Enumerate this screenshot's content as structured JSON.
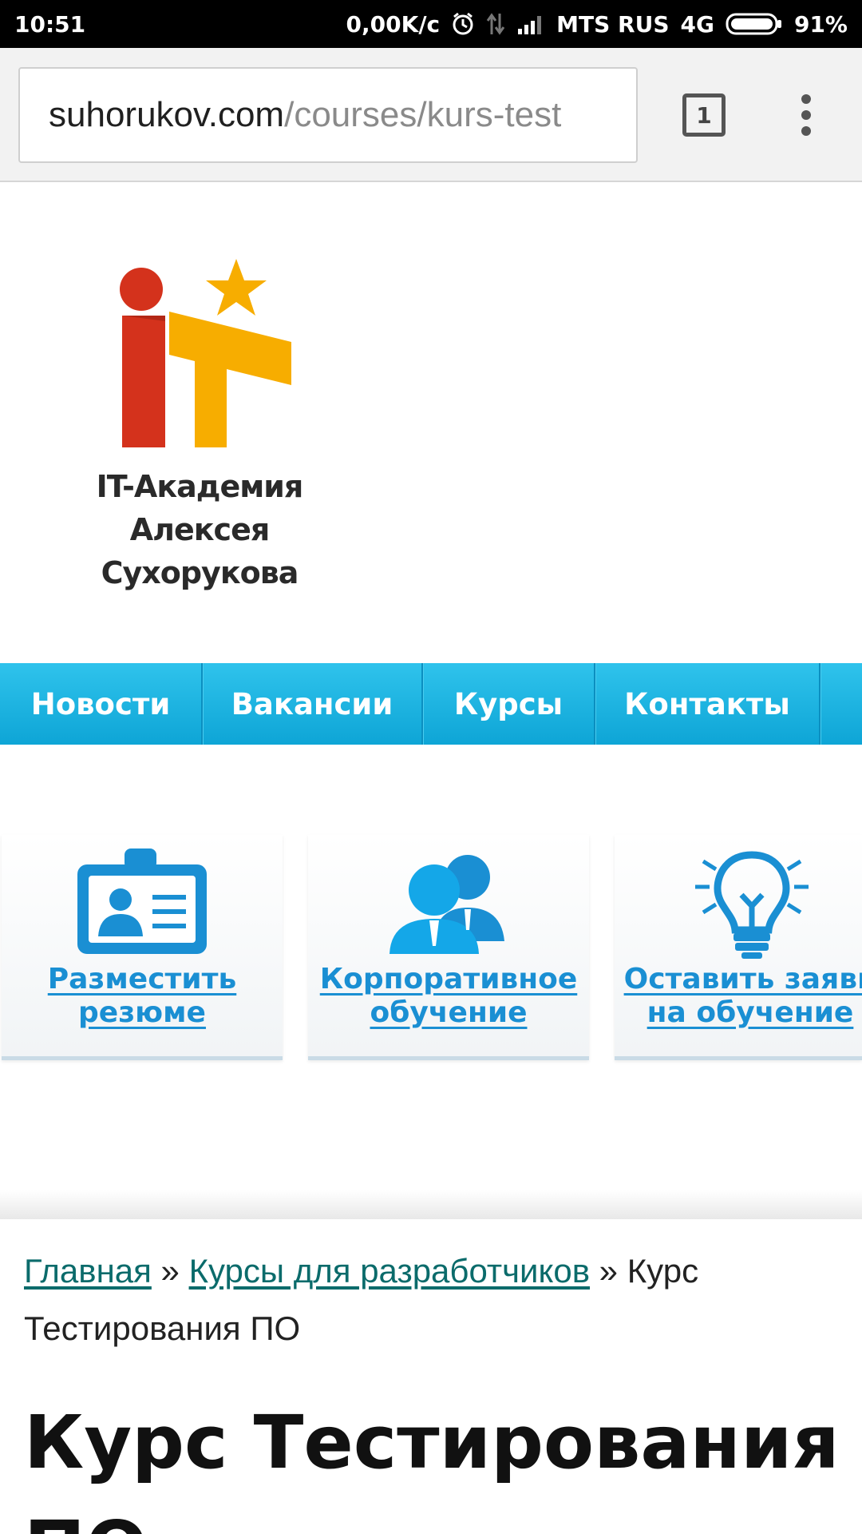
{
  "status_bar": {
    "time": "10:51",
    "net_speed": "0,00K/c",
    "carrier": "MTS RUS",
    "network": "4G",
    "battery": "91%"
  },
  "browser": {
    "url_host": "suhorukov.com",
    "url_path": "/courses/kurs-test",
    "tab_count": "1"
  },
  "logo": {
    "line1": "IT-Академия",
    "line2": "Алексея Сухорукова",
    "colors": {
      "i": "#d4321c",
      "t": "#f7ad00",
      "star": "#f7ad00"
    }
  },
  "nav": {
    "items": [
      {
        "label": "Новости"
      },
      {
        "label": "Вакансии"
      },
      {
        "label": "Курсы"
      },
      {
        "label": "Контакты"
      },
      {
        "label": ""
      }
    ]
  },
  "cards": [
    {
      "line1": "Разместить",
      "line2": "резюме",
      "icon": "resume-badge-icon"
    },
    {
      "line1": "Корпоративное",
      "line2": "обучение",
      "icon": "people-group-icon"
    },
    {
      "line1": "Оставить заявк",
      "line2": "на обучение",
      "icon": "lightbulb-icon"
    }
  ],
  "breadcrumb": {
    "home": "Главная",
    "sep1": " » ",
    "section": "Курсы для разработчиков",
    "sep2": " » ",
    "current": "Курс Тестирования ПО"
  },
  "page": {
    "title": "Курс Тестирования",
    "title_line2": "ПО"
  },
  "accent": {
    "nav_blue": "#14b0e0",
    "card_link": "#1a8fd3",
    "breadcrumb_link": "#0b6b6b"
  }
}
